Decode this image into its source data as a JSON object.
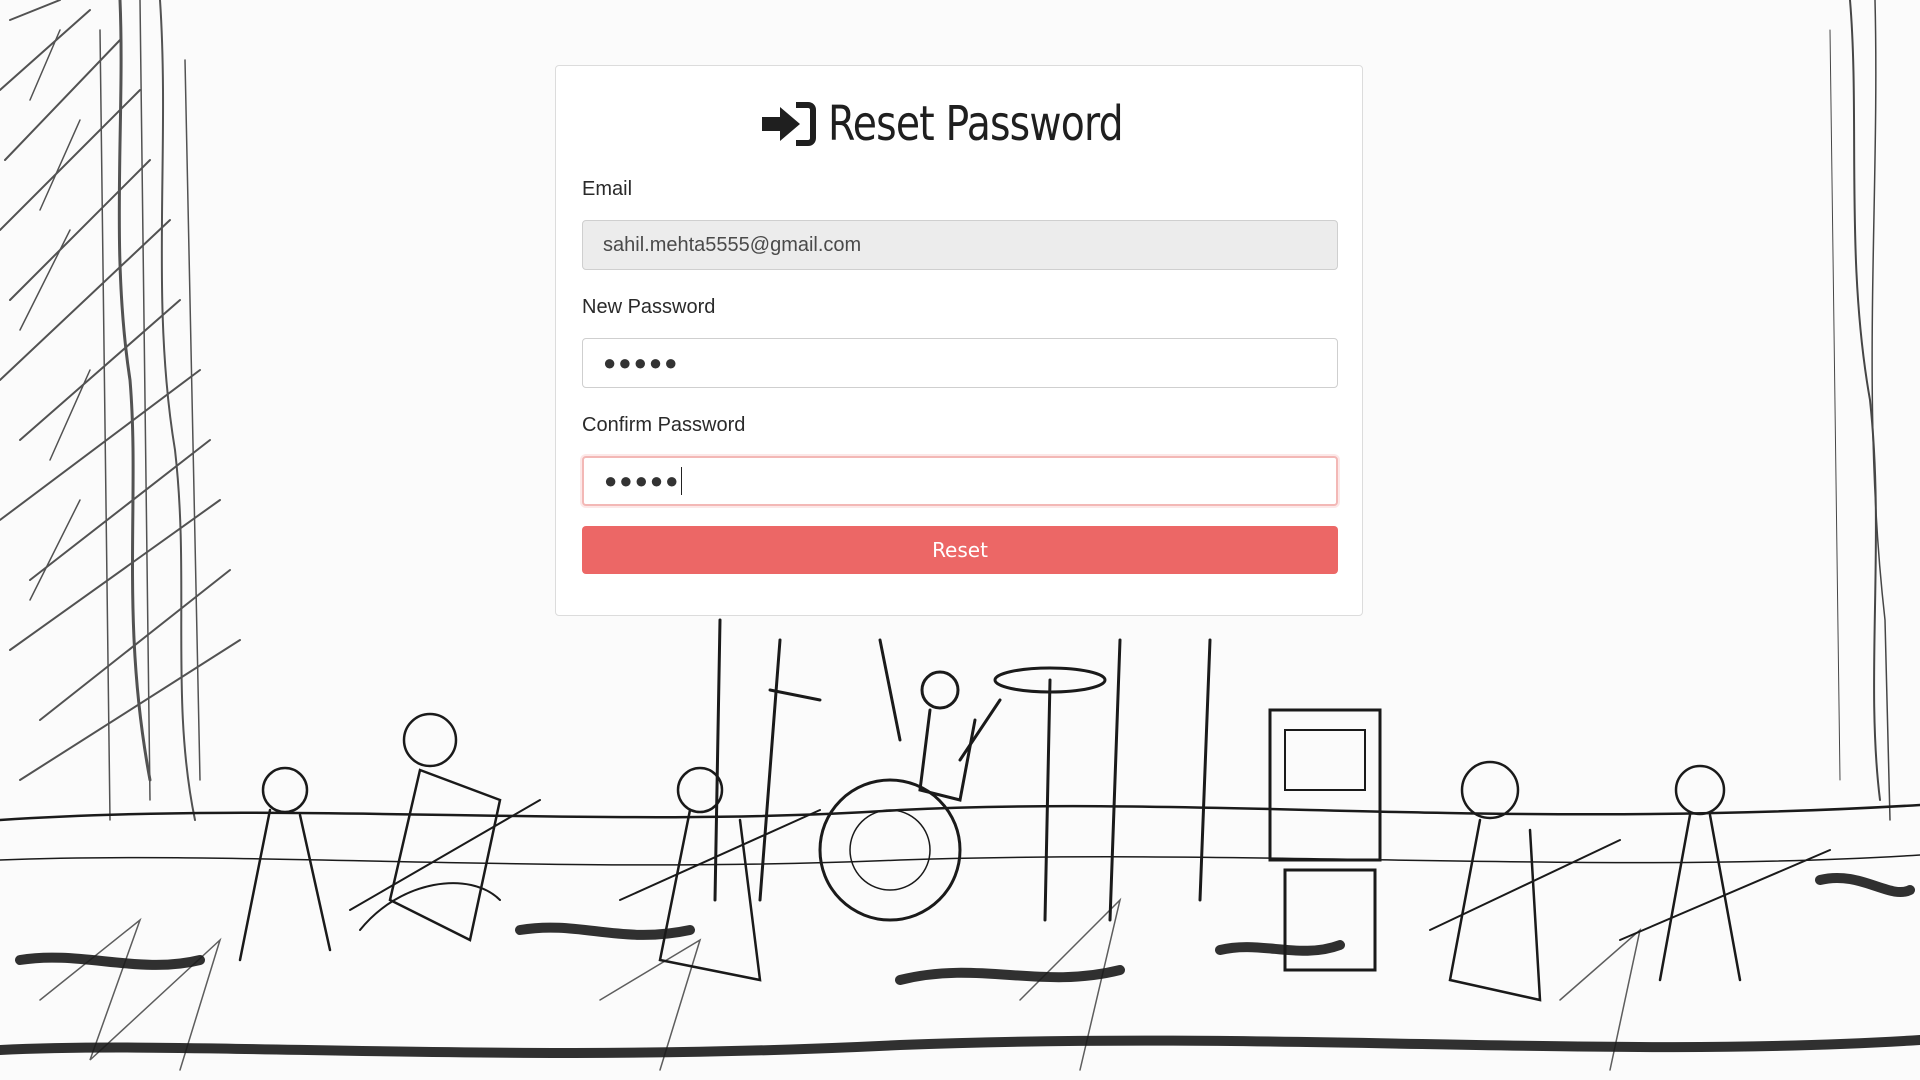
{
  "page": {
    "title": "Reset Password",
    "title_icon": "sign-in-icon"
  },
  "form": {
    "email_label": "Email",
    "email_value": "sahil.mehta5555@gmail.com",
    "new_password_label": "New Password",
    "new_password_masked": "●●●●●",
    "confirm_password_label": "Confirm Password",
    "confirm_password_masked": "●●●●●",
    "submit_label": "Reset"
  },
  "colors": {
    "accent": "#ec6766",
    "readonly_field": "#ececec",
    "focus_border": "#f3b8b6"
  }
}
